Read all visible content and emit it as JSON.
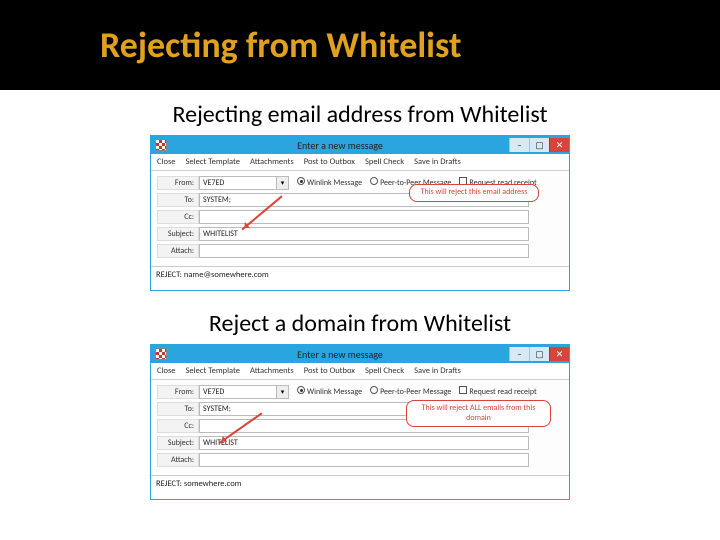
{
  "slide": {
    "title": "Rejecting from Whitelist",
    "section1_heading": "Rejecting email address from Whitelist",
    "section2_heading": "Reject a domain from Whitelist"
  },
  "window": {
    "title": "Enter a new message",
    "toolbar": {
      "close": "Close",
      "select_template": "Select Template",
      "attachments": "Attachments",
      "post_to_outbox": "Post to Outbox",
      "spell_check": "Spell Check",
      "save_in_drafts": "Save in Drafts"
    },
    "labels": {
      "from": "From:",
      "to": "To:",
      "cc": "Cc:",
      "subject": "Subject:",
      "attach": "Attach:"
    },
    "radio": {
      "winlink": "Winlink Message",
      "p2p": "Peer-to-Peer Message"
    },
    "checkbox": "Request read receipt",
    "win_btns": {
      "min": "–",
      "max": "▢",
      "close": "✕"
    }
  },
  "example1": {
    "from": "VE7ED",
    "to": "SYSTEM;",
    "cc": "",
    "subject": "WHITELIST",
    "body": "REJECT: name@somewhere.com",
    "callout": "This will reject this email address"
  },
  "example2": {
    "from": "VE7ED",
    "to": "SYSTEM;",
    "cc": "",
    "subject": "WHITELIST",
    "body": "REJECT: somewhere.com",
    "callout": "This will reject ALL emails from this domain"
  }
}
